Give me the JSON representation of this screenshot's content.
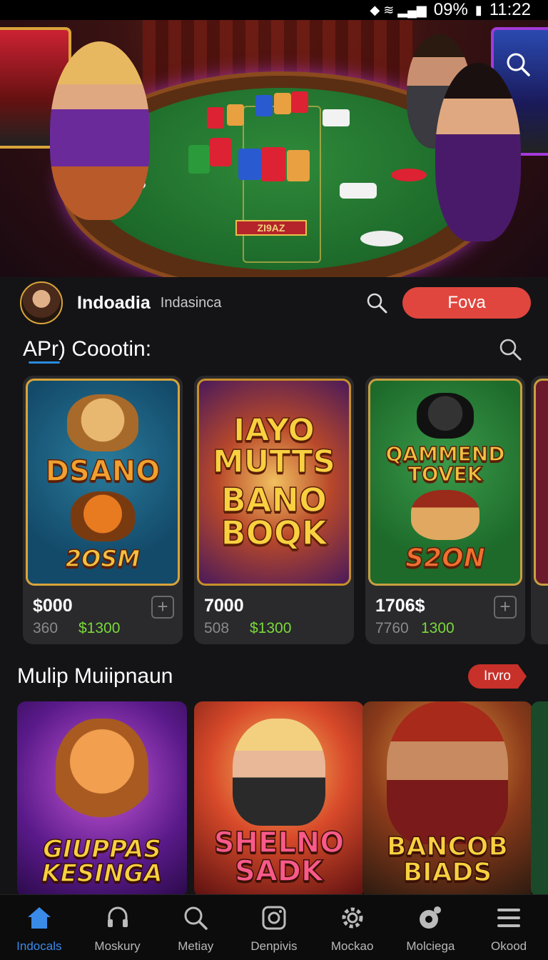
{
  "status_bar": {
    "battery": "09%",
    "time": "11:22"
  },
  "hero": {
    "table_label": "ZI9AZ"
  },
  "profile": {
    "name": "Indoadia",
    "subtitle": "Indasinca",
    "button_label": "Fova"
  },
  "section1": {
    "title": "APr) Coootin:",
    "cards": [
      {
        "art_line1": "DSANO",
        "art_line2": "2OSM",
        "price": "$000",
        "old_price": "360",
        "new_price": "$1300"
      },
      {
        "art_line1": "IAYO MUTTS",
        "art_line2": "BANO BOQK",
        "price": "7000",
        "old_price": "508",
        "new_price": "$1300"
      },
      {
        "art_line1": "QAMMEND TOVEK",
        "art_line2": "S2ON",
        "price": "1706$",
        "old_price": "7760",
        "new_price": "1300"
      }
    ]
  },
  "section2": {
    "title": "Mulip Muiipnaun",
    "badge": "Irvro",
    "promos": [
      {
        "text": "GIUPPAS KESINGA"
      },
      {
        "text": "SHELNO SADK"
      },
      {
        "text": "BANCOB BIADS"
      }
    ]
  },
  "nav": [
    {
      "label": "Indocals",
      "icon": "home-icon",
      "active": true
    },
    {
      "label": "Moskury",
      "icon": "headset-icon",
      "active": false
    },
    {
      "label": "Metiay",
      "icon": "search-icon",
      "active": false
    },
    {
      "label": "Denpivis",
      "icon": "camera-icon",
      "active": false
    },
    {
      "label": "Mockao",
      "icon": "gear-icon",
      "active": false
    },
    {
      "label": "Molciega",
      "icon": "chip-icon",
      "active": false
    },
    {
      "label": "Okood",
      "icon": "menu-icon",
      "active": false
    }
  ],
  "colors": {
    "accent": "#e0463e",
    "active_nav": "#3a8ae8",
    "price_green": "#7ad93a",
    "background": "#141416"
  }
}
